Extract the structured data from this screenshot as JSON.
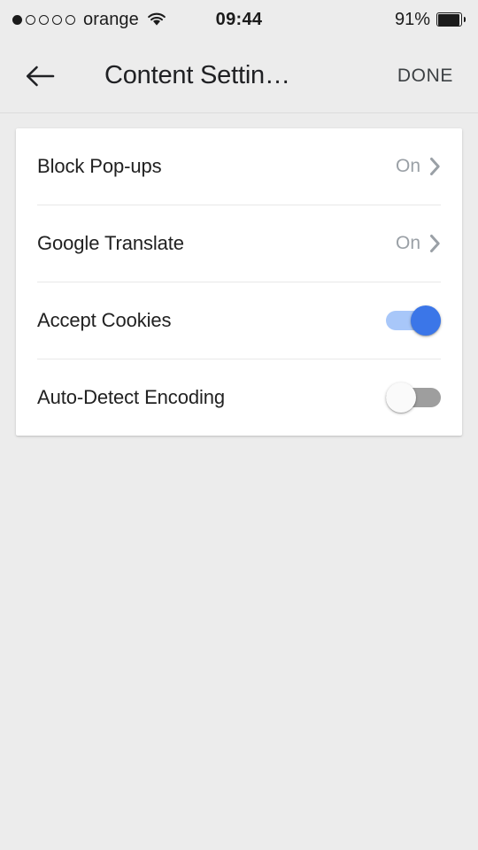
{
  "status_bar": {
    "signal_total_dots": 5,
    "signal_filled_dots": 1,
    "carrier": "orange",
    "wifi_icon": "wifi-icon",
    "time": "09:44",
    "battery_percent": "91%",
    "battery_level": 0.91
  },
  "app_bar": {
    "back_icon": "back-arrow-icon",
    "title": "Content Settin…",
    "done_label": "DONE"
  },
  "colors": {
    "page_background": "#ececec",
    "card_background": "#ffffff",
    "toggle_on_track": "#a8c7f9",
    "toggle_on_knob": "#3b76e8",
    "toggle_off_track": "#9e9e9e",
    "toggle_off_knob": "#fafafa",
    "label_text": "#212121",
    "value_text": "#9aa0a6"
  },
  "settings": {
    "rows": [
      {
        "label": "Block Pop-ups",
        "type": "link",
        "value": "On",
        "chevron_icon": "chevron-right-icon"
      },
      {
        "label": "Google Translate",
        "type": "link",
        "value": "On",
        "chevron_icon": "chevron-right-icon"
      },
      {
        "label": "Accept Cookies",
        "type": "switch",
        "checked": true
      },
      {
        "label": "Auto-Detect Encoding",
        "type": "switch",
        "checked": false
      }
    ]
  }
}
